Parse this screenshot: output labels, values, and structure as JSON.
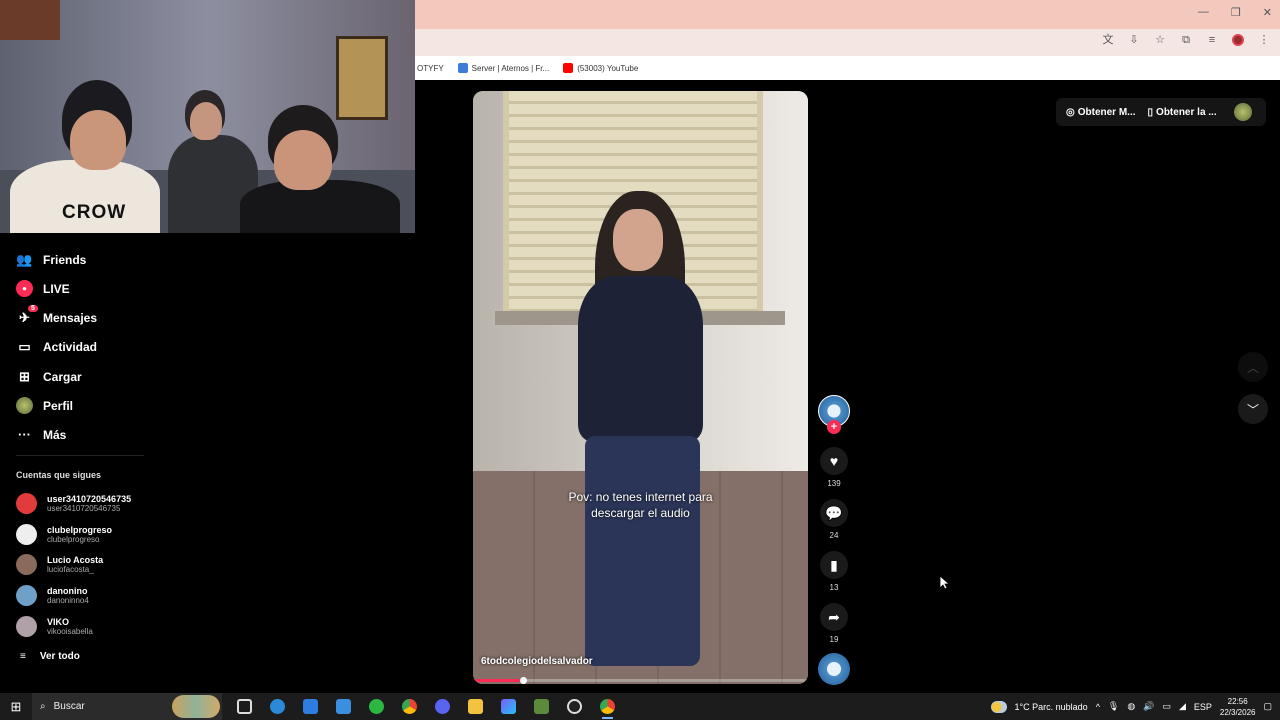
{
  "browser": {
    "bookmarks": [
      {
        "label": "OTYFY",
        "color": "#ffffff"
      },
      {
        "label": "Server | Aternos | Fr...",
        "color": "#3d7dd8"
      },
      {
        "label": "(53003) YouTube",
        "color": "#ff0000"
      }
    ]
  },
  "webcam": {
    "shirt_text": "CROW"
  },
  "sidebar": {
    "nav": [
      {
        "label": "Friends",
        "icon": "friends-icon",
        "glyph": "👥"
      },
      {
        "label": "LIVE",
        "icon": "live-icon",
        "glyph": "●"
      },
      {
        "label": "Mensajes",
        "icon": "messages-icon",
        "glyph": "✈",
        "badge": "5"
      },
      {
        "label": "Actividad",
        "icon": "activity-icon",
        "glyph": "▭"
      },
      {
        "label": "Cargar",
        "icon": "upload-icon",
        "glyph": "⊞"
      },
      {
        "label": "Perfil",
        "icon": "profile-icon",
        "glyph": "◉"
      },
      {
        "label": "Más",
        "icon": "more-icon",
        "glyph": "···"
      }
    ],
    "following_title": "Cuentas que sigues",
    "accounts": [
      {
        "name": "user3410720546735",
        "handle": "user3410720546735",
        "color": "#e23b3b"
      },
      {
        "name": "clubelprogreso",
        "handle": "clubelprogreso",
        "color": "#eeeeee"
      },
      {
        "name": "Lucio Acosta",
        "handle": "luciofacosta_",
        "color": "#8a6a5a"
      },
      {
        "name": "danonino",
        "handle": "danoninno4",
        "color": "#6fa0c8"
      },
      {
        "name": "VIKO",
        "handle": "vikooisabella",
        "color": "#b0a0a8"
      }
    ],
    "see_all": "Ver todo"
  },
  "video": {
    "caption": "Pov: no tenes internet para\ndescargar el audio",
    "username": "6todcolegiodelsalvador",
    "progress": 0.15
  },
  "actions": {
    "likes": "139",
    "comments": "24",
    "saves": "13",
    "shares": "19"
  },
  "topright": {
    "btn1": "Obtener M...",
    "btn2": "Obtener la ..."
  },
  "taskbar": {
    "search_placeholder": "Buscar",
    "weather": "1°C  Parc. nublado",
    "lang": "ESP",
    "time": "22:56",
    "date": "22/3/2026"
  }
}
